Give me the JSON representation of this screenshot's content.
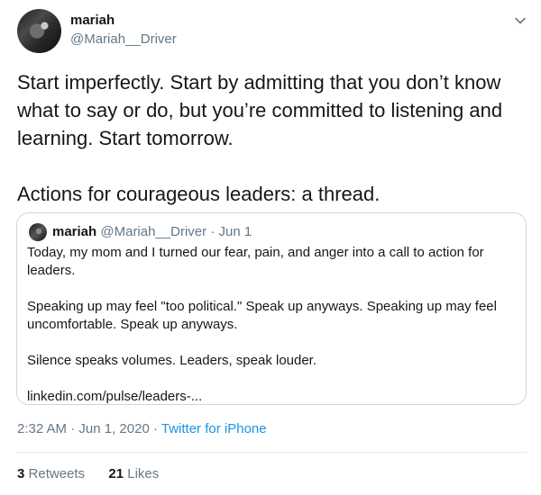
{
  "author": {
    "name": "mariah",
    "handle": "@Mariah__Driver"
  },
  "tweet": {
    "text": "Start imperfectly. Start by admitting that you don’t know what to say or do, but you’re committed to listening and learning. Start tomorrow.\n\nActions for courageous leaders: a thread."
  },
  "quoted": {
    "name": "mariah",
    "handle": "@Mariah__Driver",
    "separator": "·",
    "date": "Jun 1",
    "text": "Today, my mom and I turned our fear, pain, and anger into a call to action for leaders.\n\nSpeaking up may feel \"too political.\" Speak up anyways. Speaking up may feel uncomfortable. Speak up anyways.\n\nSilence speaks volumes. Leaders, speak louder.\n\nlinkedin.com/pulse/leaders-..."
  },
  "meta": {
    "time": "2:32 AM",
    "date": "Jun 1, 2020",
    "separator": "·",
    "source": "Twitter for iPhone"
  },
  "stats": {
    "retweets_count": "3",
    "retweets_label": "Retweets",
    "likes_count": "21",
    "likes_label": "Likes"
  },
  "icons": {
    "menu": "chevron-down-icon"
  }
}
